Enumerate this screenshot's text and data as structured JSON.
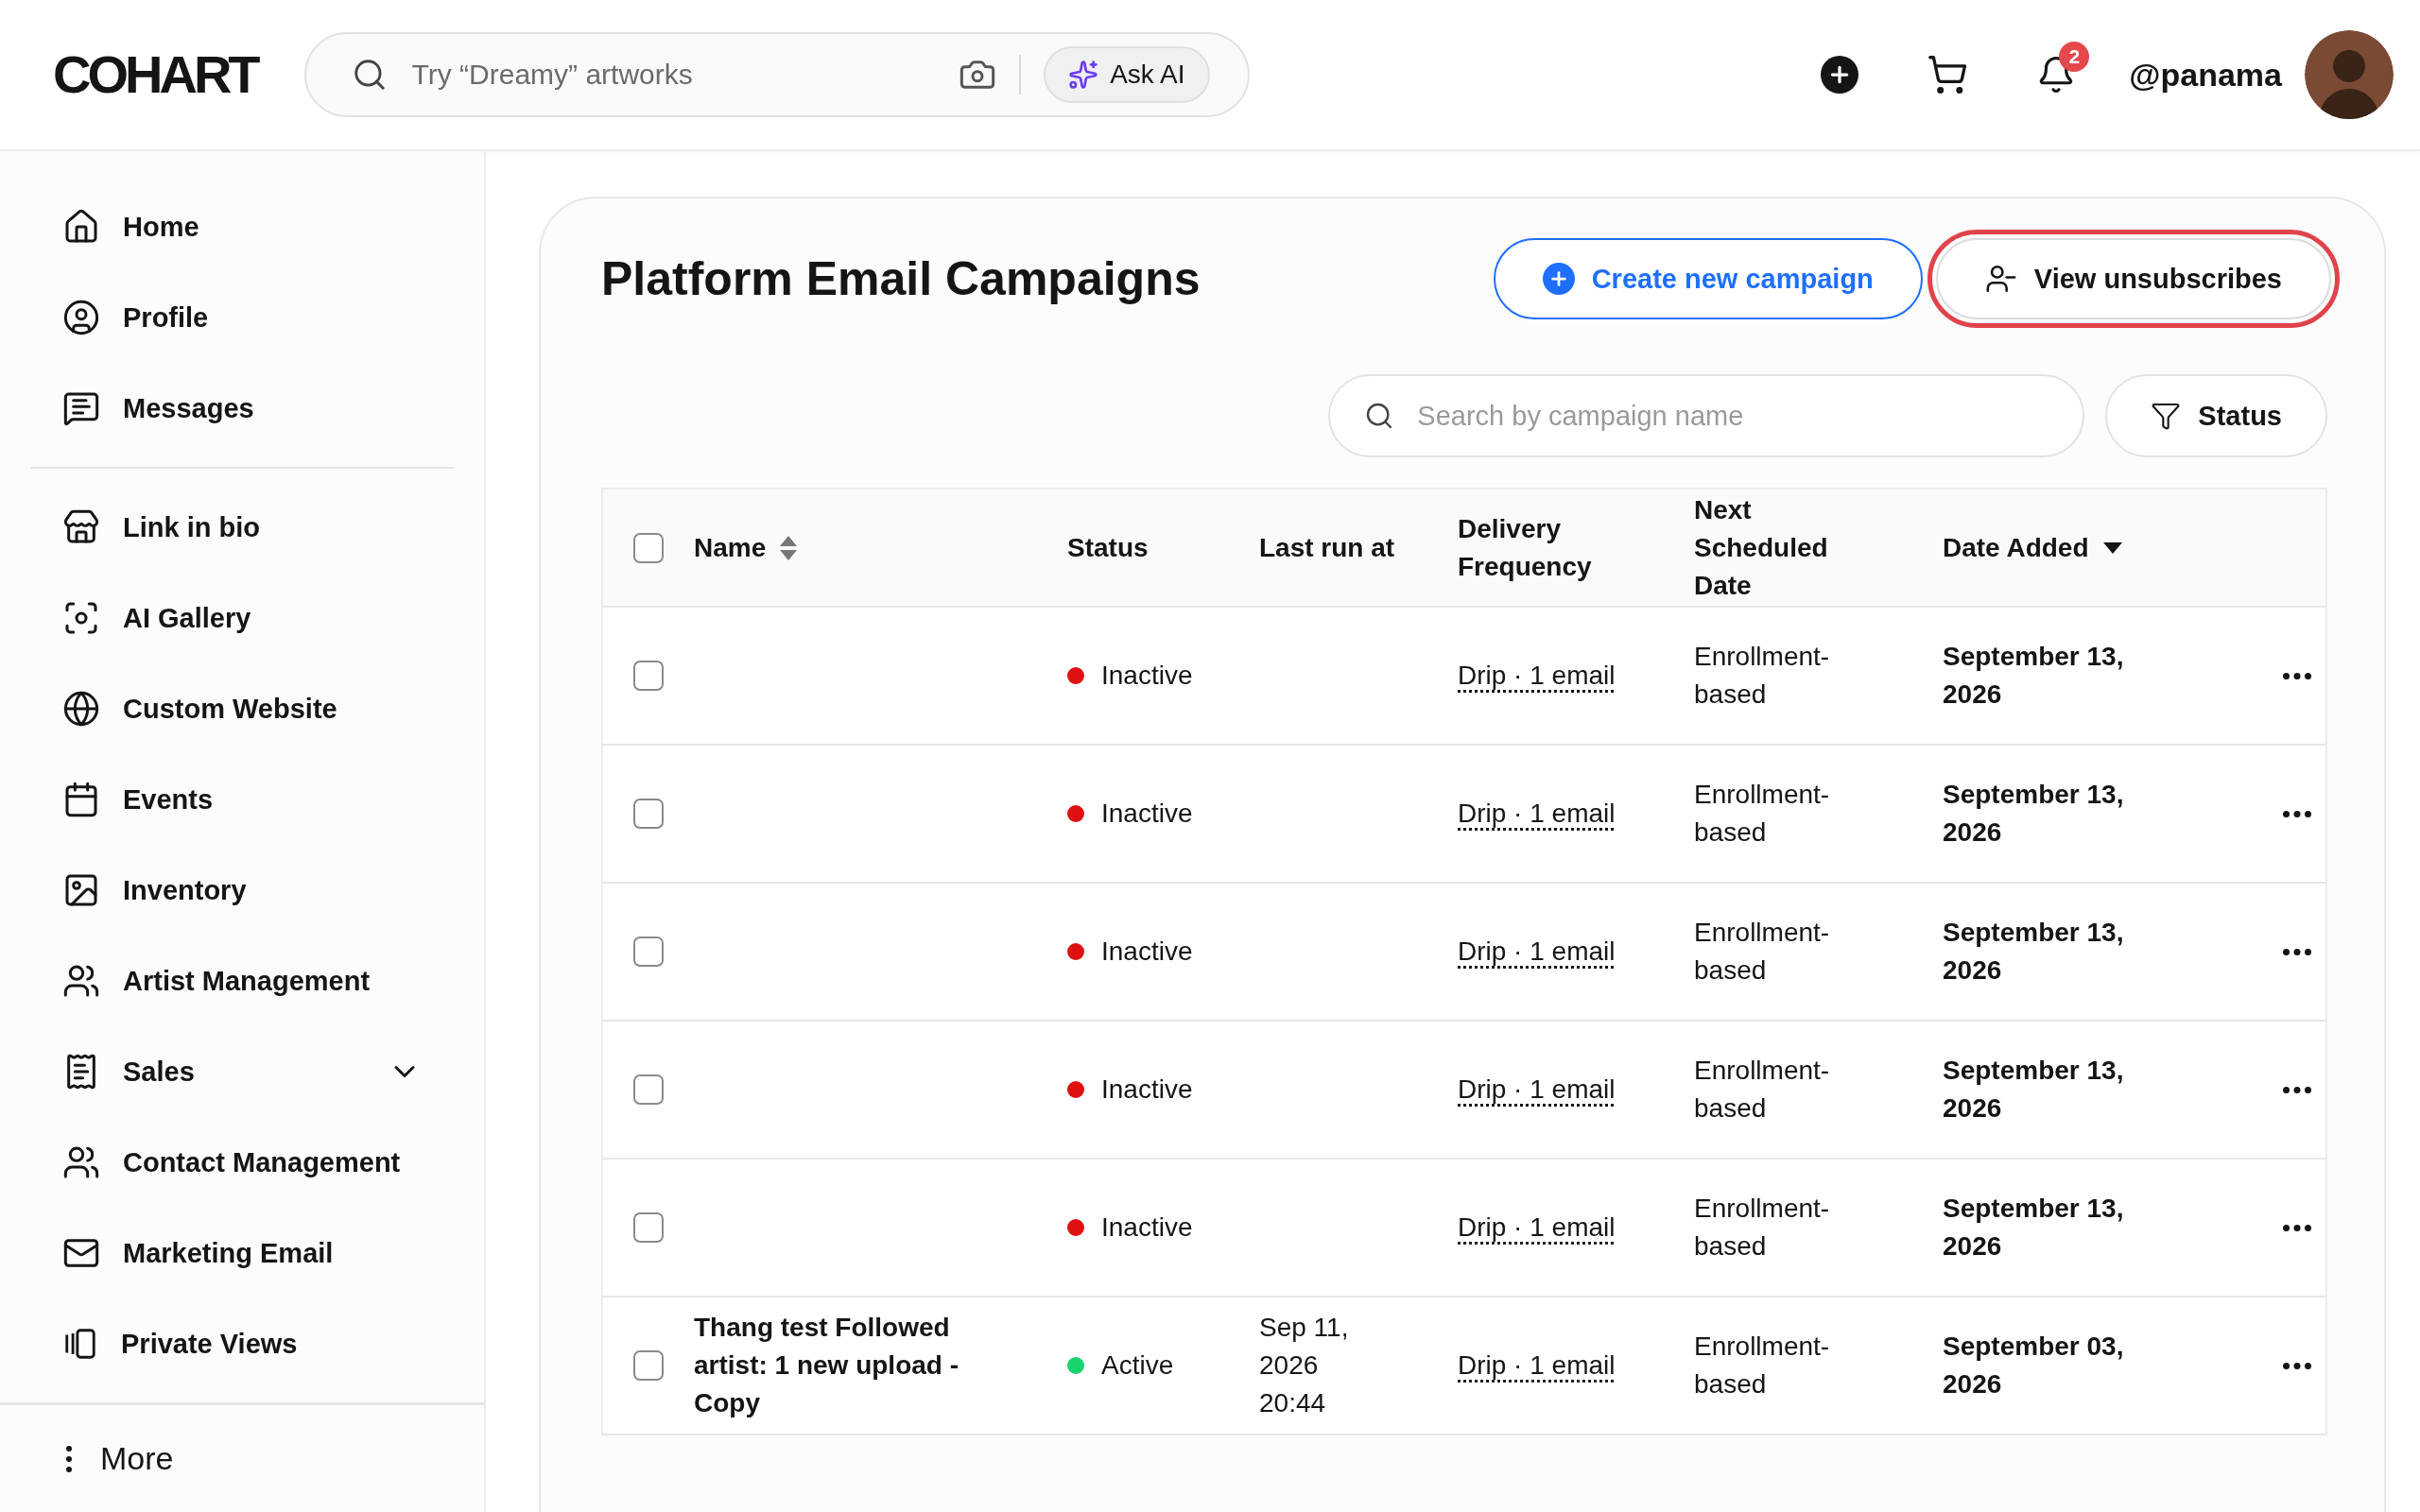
{
  "header": {
    "logo": "COHART",
    "search": {
      "placeholder": "Try “Dreamy” artworks"
    },
    "ask_ai": "Ask AI",
    "notifications": "2",
    "username": "@panama"
  },
  "sidebar": {
    "groups": [
      [
        {
          "label": "Home"
        },
        {
          "label": "Profile"
        },
        {
          "label": "Messages"
        }
      ],
      [
        {
          "label": "Link in bio"
        },
        {
          "label": "AI Gallery"
        },
        {
          "label": "Custom Website"
        },
        {
          "label": "Events"
        },
        {
          "label": "Inventory"
        },
        {
          "label": "Artist Management"
        },
        {
          "label": "Sales",
          "kind": "group",
          "expanded": false
        },
        {
          "label": "Contact Management"
        },
        {
          "label": "Marketing Email"
        },
        {
          "label": "Private Views"
        }
      ]
    ],
    "more": "More"
  },
  "page": {
    "title": "Platform Email Campaigns",
    "buttons": [
      {
        "label": "Create new campaign",
        "kind": "primary",
        "highlighted": false
      },
      {
        "label": "View unsubscribes",
        "kind": "secondary",
        "highlighted": true
      }
    ],
    "search": {
      "placeholder": "Search by campaign name"
    },
    "filter": "Status"
  },
  "table": {
    "select_all": {
      "checked": false
    },
    "columns": [
      {
        "label": "Name",
        "sorted": false
      },
      {
        "label": "Status"
      },
      {
        "label": "Last run at"
      },
      {
        "label": "Delivery Frequency"
      },
      {
        "label": "Next Scheduled Date"
      },
      {
        "label": "Date Added",
        "sorted": true
      }
    ],
    "rows": [
      {
        "checked": false,
        "status": {
          "label": "Inactive",
          "kind": "inactive"
        },
        "delivery": "Drip · 1 email",
        "next": "Enrollment-based",
        "date_added": "September 13, 2026"
      },
      {
        "checked": false,
        "status": {
          "label": "Inactive",
          "kind": "inactive"
        },
        "delivery": "Drip · 1 email",
        "next": "Enrollment-based",
        "date_added": "September 13, 2026"
      },
      {
        "checked": false,
        "status": {
          "label": "Inactive",
          "kind": "inactive"
        },
        "delivery": "Drip · 1 email",
        "next": "Enrollment-based",
        "date_added": "September 13, 2026"
      },
      {
        "checked": false,
        "status": {
          "label": "Inactive",
          "kind": "inactive"
        },
        "delivery": "Drip · 1 email",
        "next": "Enrollment-based",
        "date_added": "September 13, 2026"
      },
      {
        "checked": false,
        "status": {
          "label": "Inactive",
          "kind": "inactive"
        },
        "delivery": "Drip · 1 email",
        "next": "Enrollment-based",
        "date_added": "September 13, 2026"
      },
      {
        "checked": false,
        "name": "Thang test Followed artist: 1 new upload - Copy",
        "status": {
          "label": "Active",
          "kind": "active"
        },
        "last_run": "Sep 11, 2026 20:44",
        "delivery": "Drip · 1 email",
        "next": "Enrollment-based",
        "date_added": "September 03, 2026"
      }
    ]
  }
}
